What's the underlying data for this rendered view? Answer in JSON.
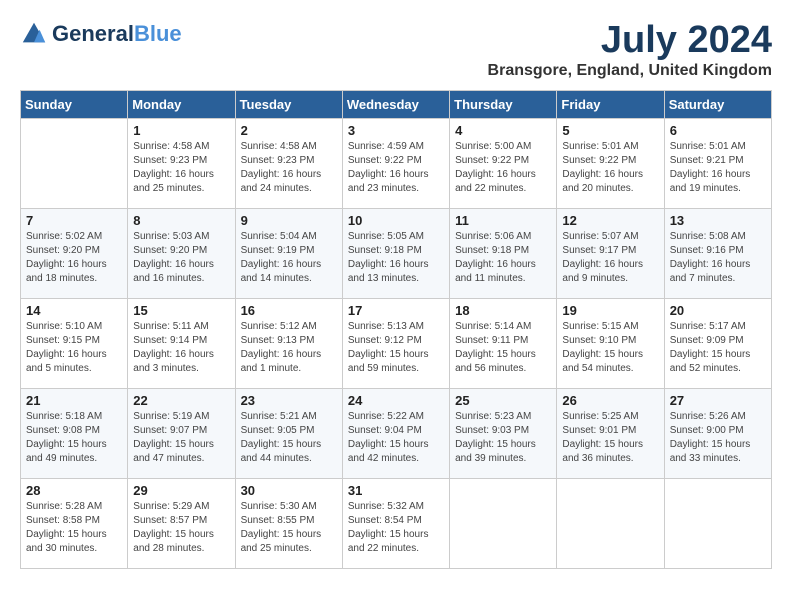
{
  "logo": {
    "line1": "General",
    "line2": "Blue"
  },
  "title": "July 2024",
  "location": "Bransgore, England, United Kingdom",
  "weekdays": [
    "Sunday",
    "Monday",
    "Tuesday",
    "Wednesday",
    "Thursday",
    "Friday",
    "Saturday"
  ],
  "weeks": [
    [
      {
        "day": "",
        "sunrise": "",
        "sunset": "",
        "daylight": ""
      },
      {
        "day": "1",
        "sunrise": "Sunrise: 4:58 AM",
        "sunset": "Sunset: 9:23 PM",
        "daylight": "Daylight: 16 hours and 25 minutes."
      },
      {
        "day": "2",
        "sunrise": "Sunrise: 4:58 AM",
        "sunset": "Sunset: 9:23 PM",
        "daylight": "Daylight: 16 hours and 24 minutes."
      },
      {
        "day": "3",
        "sunrise": "Sunrise: 4:59 AM",
        "sunset": "Sunset: 9:22 PM",
        "daylight": "Daylight: 16 hours and 23 minutes."
      },
      {
        "day": "4",
        "sunrise": "Sunrise: 5:00 AM",
        "sunset": "Sunset: 9:22 PM",
        "daylight": "Daylight: 16 hours and 22 minutes."
      },
      {
        "day": "5",
        "sunrise": "Sunrise: 5:01 AM",
        "sunset": "Sunset: 9:22 PM",
        "daylight": "Daylight: 16 hours and 20 minutes."
      },
      {
        "day": "6",
        "sunrise": "Sunrise: 5:01 AM",
        "sunset": "Sunset: 9:21 PM",
        "daylight": "Daylight: 16 hours and 19 minutes."
      }
    ],
    [
      {
        "day": "7",
        "sunrise": "Sunrise: 5:02 AM",
        "sunset": "Sunset: 9:20 PM",
        "daylight": "Daylight: 16 hours and 18 minutes."
      },
      {
        "day": "8",
        "sunrise": "Sunrise: 5:03 AM",
        "sunset": "Sunset: 9:20 PM",
        "daylight": "Daylight: 16 hours and 16 minutes."
      },
      {
        "day": "9",
        "sunrise": "Sunrise: 5:04 AM",
        "sunset": "Sunset: 9:19 PM",
        "daylight": "Daylight: 16 hours and 14 minutes."
      },
      {
        "day": "10",
        "sunrise": "Sunrise: 5:05 AM",
        "sunset": "Sunset: 9:18 PM",
        "daylight": "Daylight: 16 hours and 13 minutes."
      },
      {
        "day": "11",
        "sunrise": "Sunrise: 5:06 AM",
        "sunset": "Sunset: 9:18 PM",
        "daylight": "Daylight: 16 hours and 11 minutes."
      },
      {
        "day": "12",
        "sunrise": "Sunrise: 5:07 AM",
        "sunset": "Sunset: 9:17 PM",
        "daylight": "Daylight: 16 hours and 9 minutes."
      },
      {
        "day": "13",
        "sunrise": "Sunrise: 5:08 AM",
        "sunset": "Sunset: 9:16 PM",
        "daylight": "Daylight: 16 hours and 7 minutes."
      }
    ],
    [
      {
        "day": "14",
        "sunrise": "Sunrise: 5:10 AM",
        "sunset": "Sunset: 9:15 PM",
        "daylight": "Daylight: 16 hours and 5 minutes."
      },
      {
        "day": "15",
        "sunrise": "Sunrise: 5:11 AM",
        "sunset": "Sunset: 9:14 PM",
        "daylight": "Daylight: 16 hours and 3 minutes."
      },
      {
        "day": "16",
        "sunrise": "Sunrise: 5:12 AM",
        "sunset": "Sunset: 9:13 PM",
        "daylight": "Daylight: 16 hours and 1 minute."
      },
      {
        "day": "17",
        "sunrise": "Sunrise: 5:13 AM",
        "sunset": "Sunset: 9:12 PM",
        "daylight": "Daylight: 15 hours and 59 minutes."
      },
      {
        "day": "18",
        "sunrise": "Sunrise: 5:14 AM",
        "sunset": "Sunset: 9:11 PM",
        "daylight": "Daylight: 15 hours and 56 minutes."
      },
      {
        "day": "19",
        "sunrise": "Sunrise: 5:15 AM",
        "sunset": "Sunset: 9:10 PM",
        "daylight": "Daylight: 15 hours and 54 minutes."
      },
      {
        "day": "20",
        "sunrise": "Sunrise: 5:17 AM",
        "sunset": "Sunset: 9:09 PM",
        "daylight": "Daylight: 15 hours and 52 minutes."
      }
    ],
    [
      {
        "day": "21",
        "sunrise": "Sunrise: 5:18 AM",
        "sunset": "Sunset: 9:08 PM",
        "daylight": "Daylight: 15 hours and 49 minutes."
      },
      {
        "day": "22",
        "sunrise": "Sunrise: 5:19 AM",
        "sunset": "Sunset: 9:07 PM",
        "daylight": "Daylight: 15 hours and 47 minutes."
      },
      {
        "day": "23",
        "sunrise": "Sunrise: 5:21 AM",
        "sunset": "Sunset: 9:05 PM",
        "daylight": "Daylight: 15 hours and 44 minutes."
      },
      {
        "day": "24",
        "sunrise": "Sunrise: 5:22 AM",
        "sunset": "Sunset: 9:04 PM",
        "daylight": "Daylight: 15 hours and 42 minutes."
      },
      {
        "day": "25",
        "sunrise": "Sunrise: 5:23 AM",
        "sunset": "Sunset: 9:03 PM",
        "daylight": "Daylight: 15 hours and 39 minutes."
      },
      {
        "day": "26",
        "sunrise": "Sunrise: 5:25 AM",
        "sunset": "Sunset: 9:01 PM",
        "daylight": "Daylight: 15 hours and 36 minutes."
      },
      {
        "day": "27",
        "sunrise": "Sunrise: 5:26 AM",
        "sunset": "Sunset: 9:00 PM",
        "daylight": "Daylight: 15 hours and 33 minutes."
      }
    ],
    [
      {
        "day": "28",
        "sunrise": "Sunrise: 5:28 AM",
        "sunset": "Sunset: 8:58 PM",
        "daylight": "Daylight: 15 hours and 30 minutes."
      },
      {
        "day": "29",
        "sunrise": "Sunrise: 5:29 AM",
        "sunset": "Sunset: 8:57 PM",
        "daylight": "Daylight: 15 hours and 28 minutes."
      },
      {
        "day": "30",
        "sunrise": "Sunrise: 5:30 AM",
        "sunset": "Sunset: 8:55 PM",
        "daylight": "Daylight: 15 hours and 25 minutes."
      },
      {
        "day": "31",
        "sunrise": "Sunrise: 5:32 AM",
        "sunset": "Sunset: 8:54 PM",
        "daylight": "Daylight: 15 hours and 22 minutes."
      },
      {
        "day": "",
        "sunrise": "",
        "sunset": "",
        "daylight": ""
      },
      {
        "day": "",
        "sunrise": "",
        "sunset": "",
        "daylight": ""
      },
      {
        "day": "",
        "sunrise": "",
        "sunset": "",
        "daylight": ""
      }
    ]
  ]
}
